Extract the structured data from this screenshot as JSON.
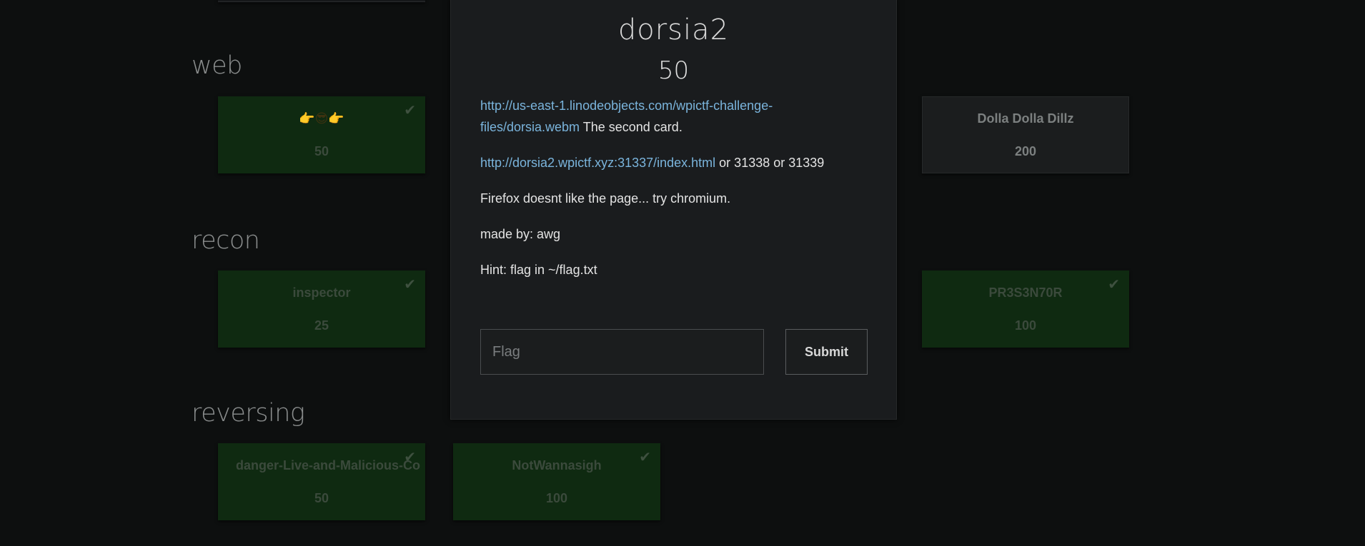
{
  "categories": [
    {
      "title": "web",
      "cards": [
        {
          "name": "👉😎👉",
          "value": "50",
          "solved": true
        },
        {
          "name": "Dolla Dolla Dillz",
          "value": "200",
          "solved": false
        }
      ]
    },
    {
      "title": "recon",
      "cards": [
        {
          "name": "inspector",
          "value": "25",
          "solved": true
        },
        {
          "name": "PR3S3N70R",
          "value": "100",
          "solved": true
        }
      ]
    },
    {
      "title": "reversing",
      "cards": [
        {
          "name": "danger-Live-and-Malicious-Co",
          "value": "50",
          "solved": true
        },
        {
          "name": "NotWannasigh",
          "value": "100",
          "solved": true
        }
      ]
    }
  ],
  "modal": {
    "title": "dorsia2",
    "value": "50",
    "link1": "http://us-east-1.linodeobjects.com/wpictf-challenge-files/dorsia.webm",
    "link1_suffix": " The second card.",
    "link2": "http://dorsia2.wpictf.xyz:31337/index.html",
    "link2_suffix": " or 31338 or 31339",
    "line3": "Firefox doesnt like the page... try chromium.",
    "line4": "made by: awg",
    "line5": "Hint: flag in ~/flag.txt",
    "flag_placeholder": "Flag",
    "submit_label": "Submit"
  },
  "icons": {
    "solved": "check-icon"
  },
  "colors": {
    "solved_card": "#0f2a11",
    "link": "#7ab4dc",
    "background": "#0d0f0f",
    "modal": "#1a1c1e"
  }
}
